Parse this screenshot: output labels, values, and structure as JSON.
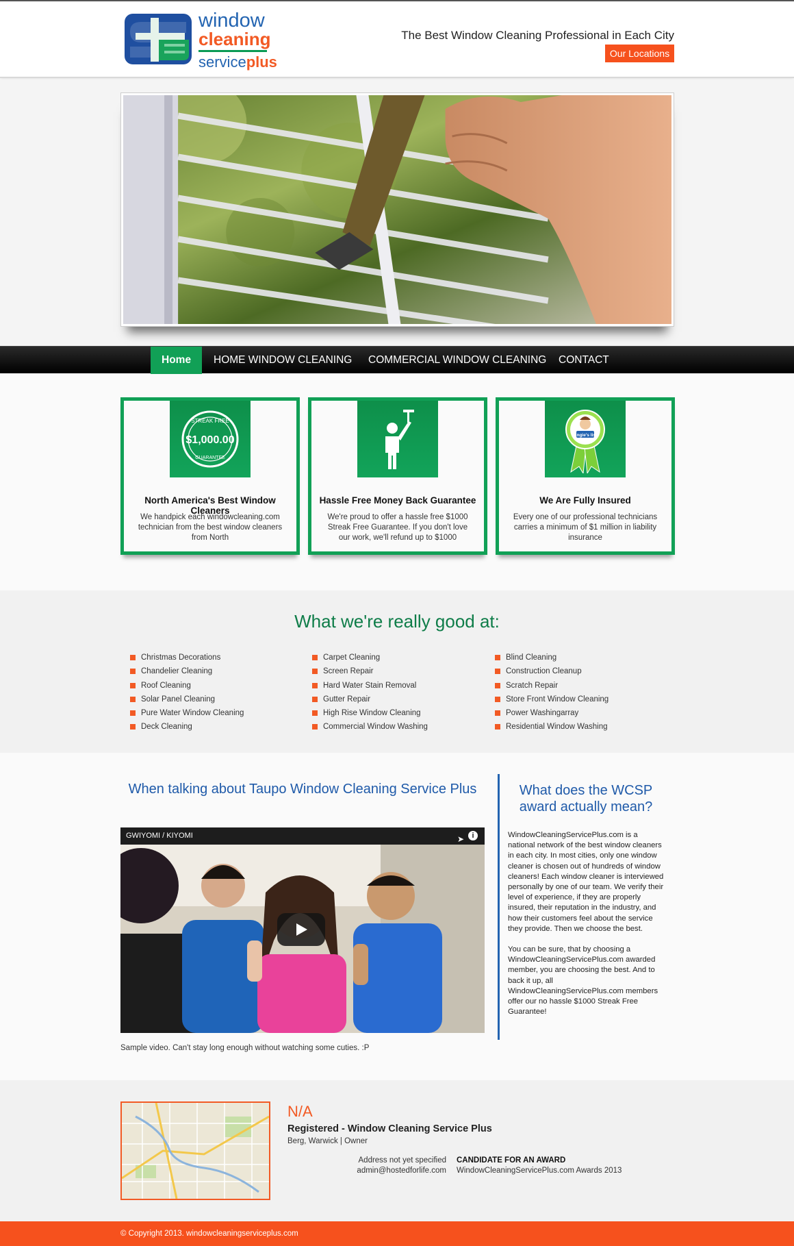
{
  "header": {
    "logo": {
      "line1": "window",
      "line2": "cleaning",
      "line3a": "service",
      "line3b": "plus"
    },
    "tagline": "The Best Window Cleaning Professional in Each City",
    "locations_button": "Our Locations"
  },
  "hero": {
    "image": "window-squeegee-photo"
  },
  "nav": {
    "items": [
      {
        "label": "Home",
        "active": true
      },
      {
        "label": "HOME WINDOW CLEANING",
        "active": false
      },
      {
        "label": "COMMERCIAL WINDOW CLEANING",
        "active": false
      },
      {
        "label": "CONTACT",
        "active": false
      }
    ]
  },
  "features": [
    {
      "icon": "streak-free-seal-icon",
      "seal_top": "STREAK FREE",
      "seal_amount": "$1,000.00",
      "seal_bottom": "GUARANTEE",
      "title": "North America's Best Window Cleaners",
      "desc": "We handpick each windowcleaning.com technician from the best window cleaners from North"
    },
    {
      "icon": "window-cleaner-person-icon",
      "title": "Hassle Free Money Back Guarantee",
      "desc": "We're proud to offer a hassle free $1000 Streak Free Guarantee. If you don't love our work, we'll refund up to $1000"
    },
    {
      "icon": "angies-list-award-icon",
      "badge_text": "Angie's list",
      "title": "We Are Fully Insured",
      "desc": "Every one of our professional technicians carries a minimum of $1 million in liability insurance"
    }
  ],
  "services": {
    "title": "What we're really good at:",
    "columns": [
      [
        "Christmas Decorations",
        "Chandelier Cleaning",
        "Roof Cleaning",
        "Solar Panel Cleaning",
        "Pure Water Window Cleaning",
        "Deck Cleaning"
      ],
      [
        "Carpet Cleaning",
        "Screen Repair",
        "Hard Water Stain Removal",
        "Gutter Repair",
        "High Rise Window Cleaning",
        "Commercial Window Washing"
      ],
      [
        "Blind Cleaning",
        "Construction Cleanup",
        "Scratch Repair",
        "Store Front Window Cleaning",
        "Power Washingarray",
        "Residential Window Washing"
      ]
    ]
  },
  "video_section": {
    "title": "When talking about Taupo Window Cleaning Service Plus",
    "video_title": "GWIYOMI / KIYOMI",
    "caption": "Sample video. Can't stay long enough without watching some cuties. :P"
  },
  "award": {
    "title": "What does the WCSP award actually mean?",
    "p1": "WindowCleaningServicePlus.com is a national network of the best window cleaners in each city. In most cities, only one window cleaner is chosen out of hundreds of window cleaners! Each window cleaner is interviewed personally by one of our team. We verify their level of experience, if they are properly insured, their reputation in the industry, and how their customers feel about the service they provide. Then we choose the best.",
    "p2": "You can be sure, that by choosing a WindowCleaningServicePlus.com awarded member, you are choosing the best. And to back it up, all WindowCleaningServicePlus.com members offer our no hassle $1000 Streak Free Guarantee!"
  },
  "contact": {
    "status": "N/A",
    "registered": "Registered - Window Cleaning Service Plus",
    "owner_line": "Berg, Warwick | Owner",
    "address": "Address not yet specified",
    "email": "admin@hostedforlife.com",
    "award_label": "CANDIDATE FOR AN AWARD",
    "award_detail": "WindowCleaningServicePlus.com Awards 2013"
  },
  "footer": {
    "copyright": "© Copyright 2013. windowcleaningserviceplus.com"
  },
  "colors": {
    "green": "#11a056",
    "orange": "#f6511d",
    "blue": "#2364b1",
    "heading_green": "#0f7d49"
  }
}
